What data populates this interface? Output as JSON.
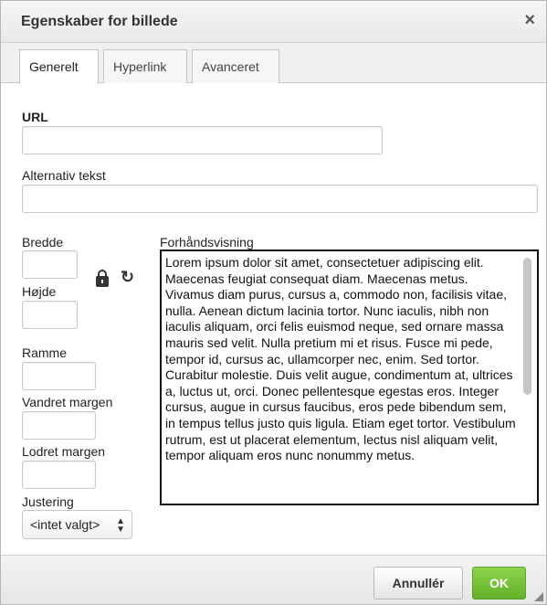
{
  "dialog": {
    "title": "Egenskaber for billede",
    "close_symbol": "×"
  },
  "tabs": [
    {
      "label": "Generelt",
      "active": true
    },
    {
      "label": "Hyperlink",
      "active": false
    },
    {
      "label": "Avanceret",
      "active": false
    }
  ],
  "form": {
    "url_label": "URL",
    "url_value": "",
    "alt_label": "Alternativ tekst",
    "alt_value": "",
    "width_label": "Bredde",
    "height_label": "Højde",
    "border_label": "Ramme",
    "hspace_label": "Vandret margen",
    "vspace_label": "Lodret margen",
    "align_label": "Justering",
    "align_value": "<intet valgt>",
    "lock_icon": "lock-icon",
    "reset_icon": "reset-size-icon"
  },
  "preview": {
    "label": "Forhåndsvisning",
    "text": "Lorem ipsum dolor sit amet, consectetuer adipiscing elit. Maecenas feugiat consequat diam. Maecenas metus. Vivamus diam purus, cursus a, commodo non, facilisis vitae, nulla. Aenean dictum lacinia tortor. Nunc iaculis, nibh non iaculis aliquam, orci felis euismod neque, sed ornare massa mauris sed velit. Nulla pretium mi et risus. Fusce mi pede, tempor id, cursus ac, ullamcorper nec, enim. Sed tortor. Curabitur molestie. Duis velit augue, condimentum at, ultrices a, luctus ut, orci. Donec pellentesque egestas eros. Integer cursus, augue in cursus faucibus, eros pede bibendum sem, in tempus tellus justo quis ligula. Etiam eget tortor. Vestibulum rutrum, est ut placerat elementum, lectus nisl aliquam velit, tempor aliquam eros nunc nonummy metus."
  },
  "footer": {
    "cancel_label": "Annullér",
    "ok_label": "OK"
  },
  "colors": {
    "ok_green": "#6cb92f",
    "preview_border": "#111111"
  }
}
